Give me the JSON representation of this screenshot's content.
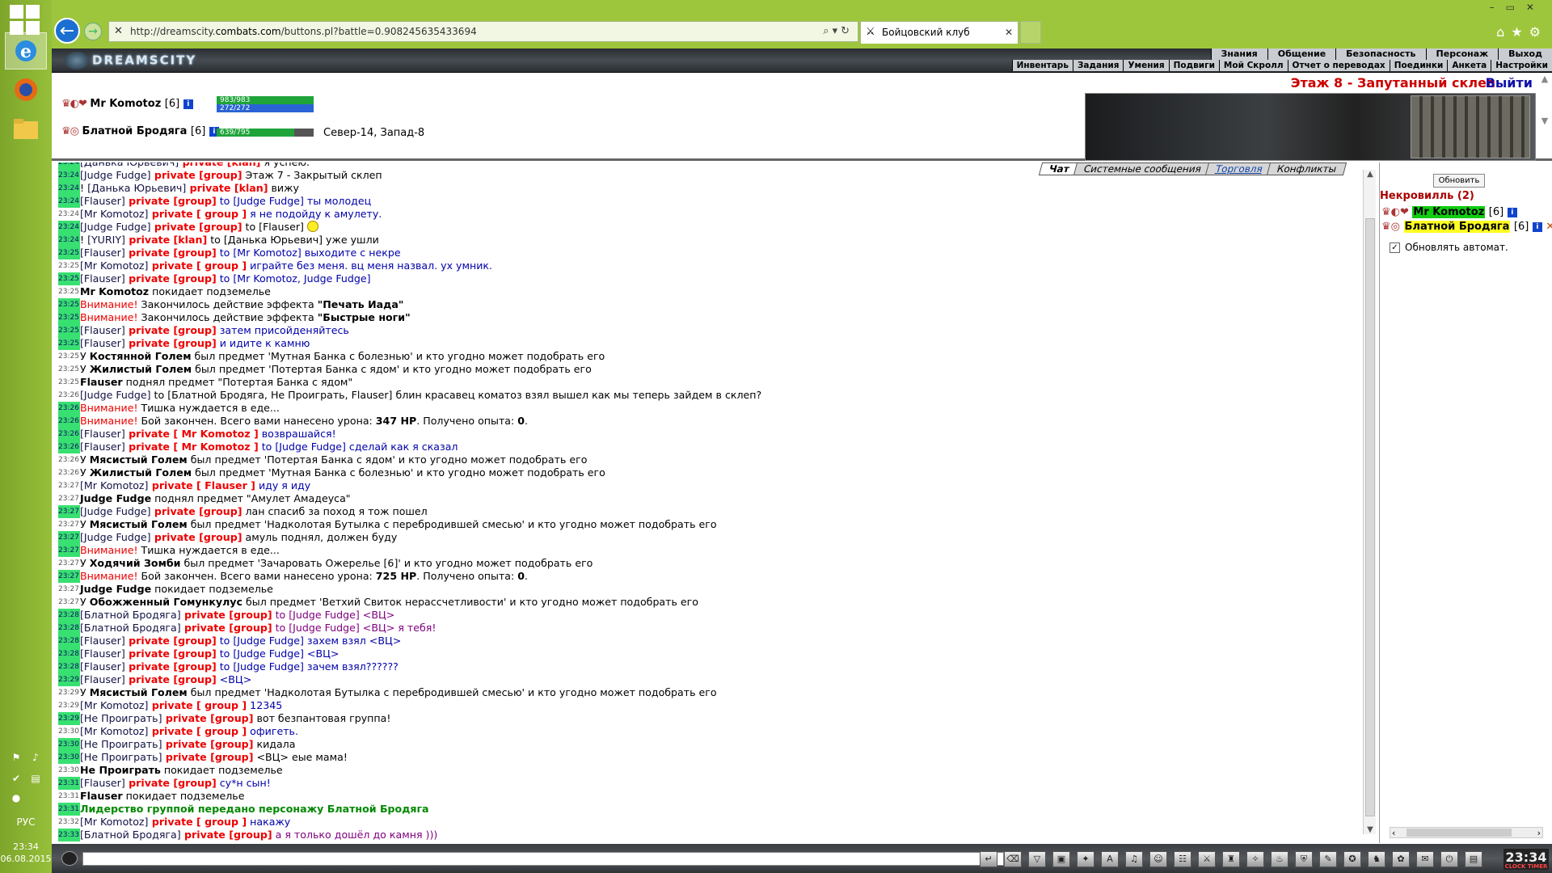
{
  "os": {
    "language": "РУС",
    "time": "23:34",
    "date": "06.08.2015"
  },
  "browser": {
    "url_prefix": "http://dreamscity.",
    "url_domain": "combats.com",
    "url_path": "/buttons.pl?battle=0.908245635433694",
    "tab_title": "Бойцовский клуб"
  },
  "game": {
    "logo": "DREAMSCITY",
    "menu_main": [
      "Знания",
      "Общение",
      "Безопасность",
      "Персонаж",
      "Выход"
    ],
    "menu_sub": [
      "Инвентарь",
      "Задания",
      "Умения",
      "Подвиги",
      "Мой Скролл",
      "Отчет о переводах",
      "Поединки",
      "Анкета",
      "Настройки"
    ],
    "location": "Этаж 8 - Запутанный склеп",
    "exit": "Выйти",
    "players": [
      {
        "name": "Mr Komotoz",
        "level": "[6]",
        "hp": "983/983",
        "mana": "272/272",
        "hp_fraction": 1.0
      },
      {
        "name": "Блатной Бродяга",
        "level": "[6]",
        "hp": "639/795",
        "hp_fraction": 0.8
      }
    ],
    "coords": "Север-14, Запад-8"
  },
  "chat": {
    "tabs": [
      "Чат",
      "Системные сообщения",
      "Торговля",
      "Конфликты"
    ],
    "messages": [
      {
        "time": "23:24",
        "hl": true,
        "parts": [
          [
            "n",
            "[Данька Юрьевич]"
          ],
          [
            "p",
            " private [klan]"
          ],
          [
            "x",
            " я успею."
          ]
        ]
      },
      {
        "time": "23:24",
        "hl": true,
        "parts": [
          [
            "n",
            "[Judge Fudge]"
          ],
          [
            "p",
            " private [group]"
          ],
          [
            "x",
            " Этаж 7 - Закрытый склеп"
          ]
        ]
      },
      {
        "time": "23:24",
        "hl": true,
        "parts": [
          [
            "x",
            "! "
          ],
          [
            "n",
            "[Данька Юрьевич]"
          ],
          [
            "p",
            " private [klan]"
          ],
          [
            "x",
            " вижу"
          ]
        ]
      },
      {
        "time": "23:24",
        "hl": true,
        "parts": [
          [
            "n",
            "[Flauser]"
          ],
          [
            "p",
            " private [group]"
          ],
          [
            "tx",
            " to [Judge Fudge] ты молодец"
          ]
        ]
      },
      {
        "time": "23:24",
        "hl": false,
        "parts": [
          [
            "n",
            "[Mr Komotoz]"
          ],
          [
            "p",
            " private [ group ]"
          ],
          [
            "tx",
            " я не подойду к амулету."
          ]
        ]
      },
      {
        "time": "23:24",
        "hl": true,
        "smile": true,
        "parts": [
          [
            "n",
            "[Judge Fudge]"
          ],
          [
            "p",
            " private [group]"
          ],
          [
            "x",
            " to [Flauser] "
          ]
        ]
      },
      {
        "time": "23:24",
        "hl": true,
        "parts": [
          [
            "x",
            "! "
          ],
          [
            "n",
            "[YURIY]"
          ],
          [
            "p",
            " private [klan]"
          ],
          [
            "x",
            " to [Данька Юрьевич] уже ушли"
          ]
        ]
      },
      {
        "time": "23:25",
        "hl": true,
        "parts": [
          [
            "n",
            "[Flauser]"
          ],
          [
            "p",
            " private [group]"
          ],
          [
            "tx",
            " to [Mr Komotoz] выходите с некре"
          ]
        ]
      },
      {
        "time": "23:25",
        "hl": false,
        "parts": [
          [
            "n",
            "[Mr Komotoz]"
          ],
          [
            "p",
            " private [ group ]"
          ],
          [
            "tx",
            " играйте без меня. вц меня назвал. ух умник."
          ]
        ]
      },
      {
        "time": "23:25",
        "hl": true,
        "parts": [
          [
            "n",
            "[Flauser]"
          ],
          [
            "p",
            " private [group]"
          ],
          [
            "tx",
            " to [Mr Komotoz, Judge Fudge]"
          ]
        ]
      },
      {
        "time": "23:25",
        "hl": false,
        "parts": [
          [
            "b",
            "Mr Komotoz"
          ],
          [
            "x",
            " покидает подземелье"
          ]
        ]
      },
      {
        "time": "23:25",
        "hl": true,
        "parts": [
          [
            "w",
            "Внимание!"
          ],
          [
            "x",
            " Закончилось действие эффекта "
          ],
          [
            "b",
            "\"Печать Иада\""
          ]
        ]
      },
      {
        "time": "23:25",
        "hl": true,
        "parts": [
          [
            "w",
            "Внимание!"
          ],
          [
            "x",
            " Закончилось действие эффекта "
          ],
          [
            "b",
            "\"Быстрые ноги\""
          ]
        ]
      },
      {
        "time": "23:25",
        "hl": true,
        "parts": [
          [
            "n",
            "[Flauser]"
          ],
          [
            "p",
            " private [group]"
          ],
          [
            "tx",
            " затем присойденяйтесь"
          ]
        ]
      },
      {
        "time": "23:25",
        "hl": true,
        "parts": [
          [
            "n",
            "[Flauser]"
          ],
          [
            "p",
            " private [group]"
          ],
          [
            "tx",
            " и идите к камню"
          ]
        ]
      },
      {
        "time": "23:25",
        "hl": false,
        "parts": [
          [
            "x",
            "У "
          ],
          [
            "b",
            "Костянной Голем"
          ],
          [
            "x",
            " был предмет 'Мутная Банка с болезнью' и кто угодно может подобрать его"
          ]
        ]
      },
      {
        "time": "23:25",
        "hl": false,
        "parts": [
          [
            "x",
            "У "
          ],
          [
            "b",
            "Жилистый Голем"
          ],
          [
            "x",
            " был предмет 'Потертая Банка с ядом' и кто угодно может подобрать его"
          ]
        ]
      },
      {
        "time": "23:25",
        "hl": false,
        "parts": [
          [
            "b",
            "Flauser"
          ],
          [
            "x",
            " поднял предмет \"Потертая Банка с ядом\""
          ]
        ]
      },
      {
        "time": "23:26",
        "hl": false,
        "parts": [
          [
            "n",
            "[Judge Fudge]"
          ],
          [
            "x",
            " to [Блатной Бродяга, Не Проиграть, Flauser] блин красавец коматоз взял вышел как мы теперь зайдем в склеп?"
          ]
        ]
      },
      {
        "time": "23:26",
        "hl": true,
        "parts": [
          [
            "w",
            "Внимание!"
          ],
          [
            "x",
            " Тишка нуждается в еде..."
          ]
        ]
      },
      {
        "time": "23:26",
        "hl": true,
        "parts": [
          [
            "w",
            "Внимание!"
          ],
          [
            "x",
            " Бой закончен. Всего вами нанесено урона: "
          ],
          [
            "b",
            "347 HP"
          ],
          [
            "x",
            ". Получено опыта: "
          ],
          [
            "b",
            "0"
          ],
          [
            "x",
            "."
          ]
        ]
      },
      {
        "time": "23:26",
        "hl": true,
        "parts": [
          [
            "n",
            "[Flauser]"
          ],
          [
            "p",
            " private [ Mr Komotoz ]"
          ],
          [
            "tx",
            " возврашайся!"
          ]
        ]
      },
      {
        "time": "23:26",
        "hl": true,
        "parts": [
          [
            "n",
            "[Flauser]"
          ],
          [
            "p",
            " private [ Mr Komotoz ]"
          ],
          [
            "tx",
            " to [Judge Fudge] сделай как я сказал"
          ]
        ]
      },
      {
        "time": "23:26",
        "hl": false,
        "parts": [
          [
            "x",
            "У "
          ],
          [
            "b",
            "Мясистый Голем"
          ],
          [
            "x",
            " был предмет 'Потертая Банка с ядом' и кто угодно может подобрать его"
          ]
        ]
      },
      {
        "time": "23:26",
        "hl": false,
        "parts": [
          [
            "x",
            "У "
          ],
          [
            "b",
            "Жилистый Голем"
          ],
          [
            "x",
            " был предмет 'Мутная Банка с болезнью' и кто угодно может подобрать его"
          ]
        ]
      },
      {
        "time": "23:27",
        "hl": false,
        "parts": [
          [
            "n",
            "[Mr Komotoz]"
          ],
          [
            "p",
            " private [ Flauser ]"
          ],
          [
            "tx",
            " иду я иду"
          ]
        ]
      },
      {
        "time": "23:27",
        "hl": false,
        "parts": [
          [
            "b",
            "Judge Fudge"
          ],
          [
            "x",
            " поднял предмет \"Амулет Амадеуса\""
          ]
        ]
      },
      {
        "time": "23:27",
        "hl": true,
        "parts": [
          [
            "n",
            "[Judge Fudge]"
          ],
          [
            "p",
            " private [group]"
          ],
          [
            "x",
            " лан спасиб за поход я тож пошел"
          ]
        ]
      },
      {
        "time": "23:27",
        "hl": false,
        "parts": [
          [
            "x",
            "У "
          ],
          [
            "b",
            "Мясистый Голем"
          ],
          [
            "x",
            " был предмет 'Надколотая Бутылка с перебродившей смесью' и кто угодно может подобрать его"
          ]
        ]
      },
      {
        "time": "23:27",
        "hl": true,
        "parts": [
          [
            "n",
            "[Judge Fudge]"
          ],
          [
            "p",
            " private [group]"
          ],
          [
            "x",
            " амуль поднял, должен буду"
          ]
        ]
      },
      {
        "time": "23:27",
        "hl": true,
        "parts": [
          [
            "w",
            "Внимание!"
          ],
          [
            "x",
            " Тишка нуждается в еде..."
          ]
        ]
      },
      {
        "time": "23:27",
        "hl": false,
        "parts": [
          [
            "x",
            "У "
          ],
          [
            "b",
            "Ходячий Зомби"
          ],
          [
            "x",
            " был предмет 'Зачарoвать Ожерелье [6]' и кто угодно может подобрать его"
          ]
        ]
      },
      {
        "time": "23:27",
        "hl": true,
        "parts": [
          [
            "w",
            "Внимание!"
          ],
          [
            "x",
            " Бой закончен. Всего вами нанесено урона: "
          ],
          [
            "b",
            "725 HP"
          ],
          [
            "x",
            ". Получено опыта: "
          ],
          [
            "b",
            "0"
          ],
          [
            "x",
            "."
          ]
        ]
      },
      {
        "time": "23:27",
        "hl": false,
        "parts": [
          [
            "b",
            "Judge Fudge"
          ],
          [
            "x",
            " покидает подземелье"
          ]
        ]
      },
      {
        "time": "23:27",
        "hl": false,
        "parts": [
          [
            "x",
            "У "
          ],
          [
            "b",
            "Обожженный Гомункулус"
          ],
          [
            "x",
            " был предмет 'Ветхий Свиток нерассчетливости' и кто угодно может подобрать его"
          ]
        ]
      },
      {
        "time": "23:28",
        "hl": true,
        "parts": [
          [
            "n",
            "[Блатной Бродяга]"
          ],
          [
            "p",
            " private [group]"
          ],
          [
            "tp",
            " to [Judge Fudge] <ВЦ>"
          ]
        ]
      },
      {
        "time": "23:28",
        "hl": true,
        "parts": [
          [
            "n",
            "[Блатной Бродяга]"
          ],
          [
            "p",
            " private [group]"
          ],
          [
            "tp",
            " to [Judge Fudge] <ВЦ> я тебя!"
          ]
        ]
      },
      {
        "time": "23:28",
        "hl": true,
        "parts": [
          [
            "n",
            "[Flauser]"
          ],
          [
            "p",
            " private [group]"
          ],
          [
            "tx",
            " to [Judge Fudge] захем взял <ВЦ>"
          ]
        ]
      },
      {
        "time": "23:28",
        "hl": true,
        "parts": [
          [
            "n",
            "[Flauser]"
          ],
          [
            "p",
            " private [group]"
          ],
          [
            "tx",
            " to [Judge Fudge] <ВЦ>"
          ]
        ]
      },
      {
        "time": "23:28",
        "hl": true,
        "parts": [
          [
            "n",
            "[Flauser]"
          ],
          [
            "p",
            " private [group]"
          ],
          [
            "tx",
            " to [Judge Fudge] зачем взял??????"
          ]
        ]
      },
      {
        "time": "23:29",
        "hl": true,
        "parts": [
          [
            "n",
            "[Flauser]"
          ],
          [
            "p",
            " private [group]"
          ],
          [
            "tx",
            " <ВЦ>"
          ]
        ]
      },
      {
        "time": "23:29",
        "hl": false,
        "parts": [
          [
            "x",
            "У "
          ],
          [
            "b",
            "Мясистый Голем"
          ],
          [
            "x",
            " был предмет 'Надколотая Бутылка с перебродившей смесью' и кто угодно может подобрать его"
          ]
        ]
      },
      {
        "time": "23:29",
        "hl": false,
        "parts": [
          [
            "n",
            "[Mr Komotoz]"
          ],
          [
            "p",
            " private [ group ]"
          ],
          [
            "tx",
            " 12345"
          ]
        ]
      },
      {
        "time": "23:29",
        "hl": true,
        "parts": [
          [
            "n",
            "[Не Проиграть]"
          ],
          [
            "p",
            " private [group]"
          ],
          [
            "x",
            " вот безпантовая группа!"
          ]
        ]
      },
      {
        "time": "23:30",
        "hl": false,
        "parts": [
          [
            "n",
            "[Mr Komotoz]"
          ],
          [
            "p",
            " private [ group ]"
          ],
          [
            "tx",
            " офигеть."
          ]
        ]
      },
      {
        "time": "23:30",
        "hl": true,
        "parts": [
          [
            "n",
            "[Не Проиграть]"
          ],
          [
            "p",
            " private [group]"
          ],
          [
            "x",
            " кидала"
          ]
        ]
      },
      {
        "time": "23:30",
        "hl": true,
        "parts": [
          [
            "n",
            "[Не Проиграть]"
          ],
          [
            "p",
            " private [group]"
          ],
          [
            "x",
            " <ВЦ> еые мама!"
          ]
        ]
      },
      {
        "time": "23:30",
        "hl": false,
        "parts": [
          [
            "b",
            "Не Проиграть"
          ],
          [
            "x",
            " покидает подземелье"
          ]
        ]
      },
      {
        "time": "23:31",
        "hl": true,
        "parts": [
          [
            "n",
            "[Flauser]"
          ],
          [
            "p",
            " private [group]"
          ],
          [
            "tx",
            " су*н сын!"
          ]
        ]
      },
      {
        "time": "23:31",
        "hl": false,
        "parts": [
          [
            "b",
            "Flauser"
          ],
          [
            "x",
            " покидает подземелье"
          ]
        ]
      },
      {
        "time": "23:31",
        "hl": true,
        "parts": [
          [
            "gr",
            "Лидерство группой передано персонажу Блатной Бродяга"
          ]
        ]
      },
      {
        "time": "23:32",
        "hl": false,
        "parts": [
          [
            "n",
            "[Mr Komotoz]"
          ],
          [
            "p",
            " private [ group ]"
          ],
          [
            "tx",
            " накажу"
          ]
        ]
      },
      {
        "time": "23:33",
        "hl": true,
        "parts": [
          [
            "n",
            "[Блатной Бродяга]"
          ],
          [
            "p",
            " private [group]"
          ],
          [
            "tp",
            " а я только дошёл до камня )))"
          ]
        ]
      }
    ]
  },
  "side": {
    "refresh": "Обновить",
    "room": "Некровилль (2)",
    "users": [
      {
        "name": "Mr Komotoz",
        "level": "[6]"
      },
      {
        "name": "Блатной Бродяга",
        "level": "[6]"
      }
    ],
    "auto_refresh": "Обновлять автомат."
  },
  "bottom": {
    "clock": "23:34",
    "clock_label": "CLOCK TIMER"
  }
}
